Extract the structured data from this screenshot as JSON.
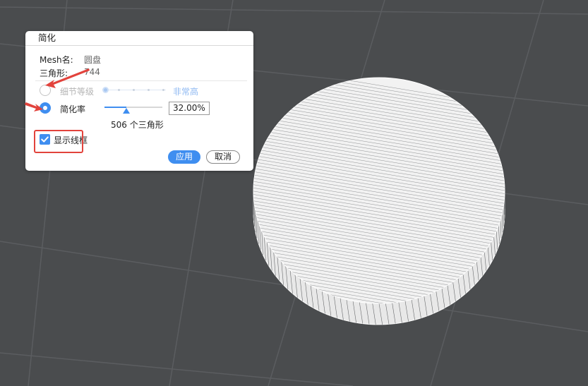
{
  "dialog": {
    "title": "简化",
    "mesh_name_label": "Mesh名:",
    "mesh_name_value": "圆盘",
    "triangles_label": "三角形:",
    "triangles_value": "744",
    "detail_level_label": "细节等级",
    "detail_level_value": "非常高",
    "simplify_ratio_label": "简化率",
    "simplify_ratio_value": "32.00%",
    "simplify_ratio_fraction": 0.32,
    "triangle_count_text": "506 个三角形",
    "show_wireframe_label": "显示线框",
    "show_wireframe_checked": true,
    "apply_label": "应用",
    "cancel_label": "取消"
  },
  "colors": {
    "accent": "#3f8ef0",
    "annotation": "#e2433c",
    "background": "#4a4c4e",
    "grid": "#5a5c5f",
    "mesh": "#ffffff"
  }
}
